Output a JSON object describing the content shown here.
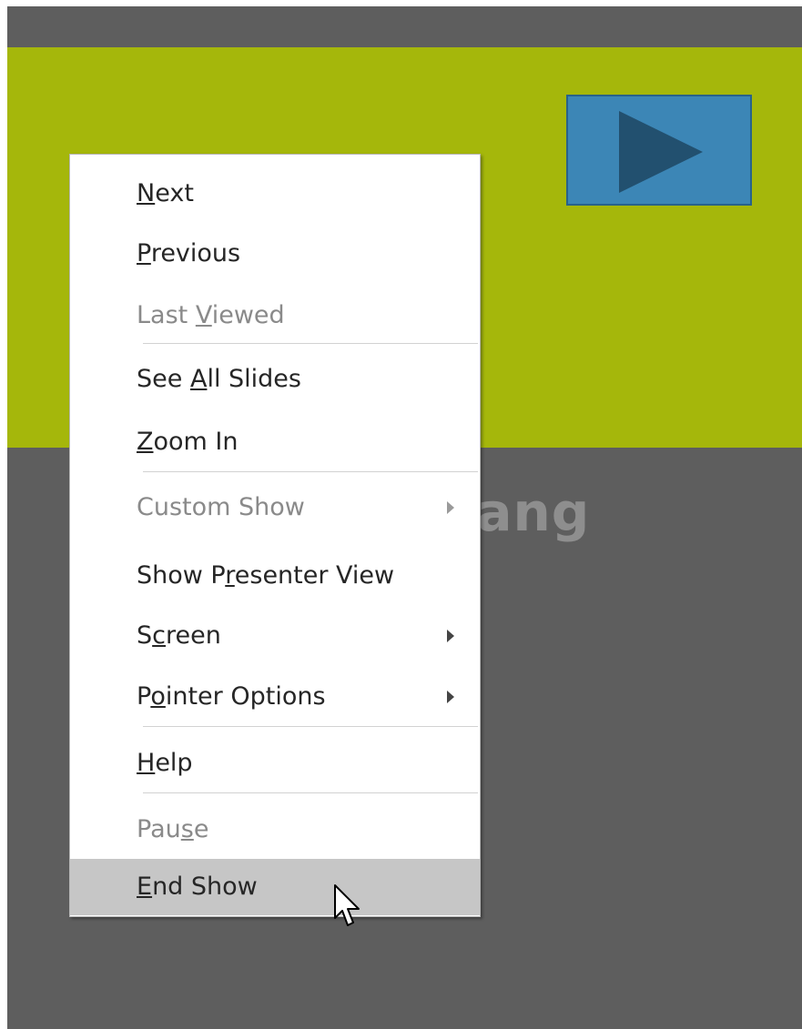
{
  "slideshow": {
    "background_color": "#5e5e5e",
    "band_color": "#a5b70b",
    "play_button_color": "#3c86b6",
    "play_button_icon": "play-icon"
  },
  "watermark": {
    "text": "uantrimang",
    "icon": "lightbulb-icon"
  },
  "context_menu": {
    "items": [
      {
        "label": "Next",
        "accel": "N",
        "enabled": true
      },
      {
        "label": "Previous",
        "accel": "P",
        "enabled": true
      },
      {
        "label": "Last Viewed",
        "accel": "V",
        "enabled": false
      },
      {
        "label": "See All Slides",
        "accel": "A",
        "enabled": true
      },
      {
        "label": "Zoom In",
        "accel": "Z",
        "enabled": true
      },
      {
        "label": "Custom Show",
        "accel": "",
        "enabled": false,
        "submenu": true
      },
      {
        "label": "Show Presenter View",
        "accel": "r",
        "enabled": true
      },
      {
        "label": "Screen",
        "accel": "c",
        "enabled": true,
        "submenu": true
      },
      {
        "label": "Pointer Options",
        "accel": "o",
        "enabled": true,
        "submenu": true
      },
      {
        "label": "Help",
        "accel": "H",
        "enabled": true
      },
      {
        "label": "Pause",
        "accel": "s",
        "enabled": false
      },
      {
        "label": "End Show",
        "accel": "E",
        "enabled": true,
        "highlighted": true
      }
    ],
    "highlight_color": "#c6c6c6"
  },
  "cursor": {
    "icon": "arrow-cursor-icon"
  }
}
